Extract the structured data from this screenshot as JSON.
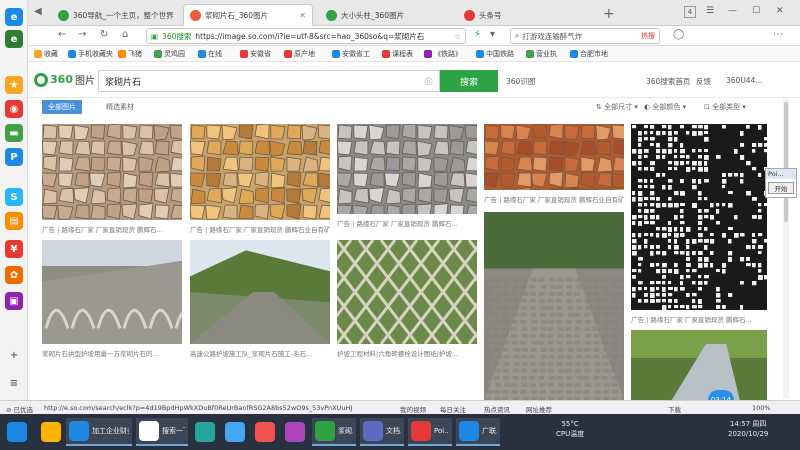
{
  "sidebar": {
    "icons": [
      {
        "name": "ie-icon",
        "glyph": "e",
        "color": "#1e88e5"
      },
      {
        "name": "ie-icon-2",
        "glyph": "e",
        "color": "#2e7d32"
      },
      {
        "name": "star-icon",
        "glyph": "★",
        "color": "#f5a623"
      },
      {
        "name": "weibo-icon",
        "glyph": "◉",
        "color": "#e53935"
      },
      {
        "name": "card-icon",
        "glyph": "▬",
        "color": "#43a047"
      },
      {
        "name": "p-icon",
        "glyph": "P",
        "color": "#1e88e5"
      },
      {
        "name": "s-icon",
        "glyph": "S",
        "color": "#29b6f6"
      },
      {
        "name": "book-icon",
        "glyph": "▤",
        "color": "#fb8c00"
      },
      {
        "name": "money-icon",
        "glyph": "¥",
        "color": "#e53935"
      },
      {
        "name": "gear-icon",
        "glyph": "✿",
        "color": "#ef6c00"
      },
      {
        "name": "box-icon",
        "glyph": "▣",
        "color": "#8e24aa"
      }
    ]
  },
  "tabs": [
    {
      "label": "360导航_一个主页，整个世界",
      "color": "#2da344"
    },
    {
      "label": "浆砌片石_360图片",
      "color": "#e85d3c",
      "active": true
    },
    {
      "label": "大小头柱_360图片",
      "color": "#2da344"
    },
    {
      "label": "头条号",
      "color": "#e53935"
    }
  ],
  "window": {
    "badge": "4"
  },
  "address": {
    "prefix": "360搜索",
    "url": "https://image.so.com/i?ie=utf-8&src=hao_360so&q=浆砌片石",
    "search_text": "打游戏连输醉气炸",
    "hot": "热搜"
  },
  "bookmarks": [
    {
      "label": "收藏",
      "color": "#f5a623"
    },
    {
      "label": "手机收藏夹",
      "color": "#1e88e5"
    },
    {
      "label": "飞猪",
      "color": "#fb8c00"
    },
    {
      "label": "灵鸡园",
      "color": "#43a047"
    },
    {
      "label": "在线",
      "color": "#1e88e5"
    },
    {
      "label": "安徽省",
      "color": "#e53935"
    },
    {
      "label": "原产地",
      "color": "#e53935"
    },
    {
      "label": "安徽省工",
      "color": "#1e88e5"
    },
    {
      "label": "课程表",
      "color": "#e53935"
    },
    {
      "label": "《铁路》",
      "color": "#8e24aa"
    },
    {
      "label": "中国铁路",
      "color": "#1e88e5"
    },
    {
      "label": "营业执",
      "color": "#43a047"
    },
    {
      "label": "合肥市地",
      "color": "#1e88e5"
    }
  ],
  "header": {
    "logo_brand": "360",
    "logo_suffix": "图片",
    "query": "浆砌片石",
    "search_button": "搜索",
    "links": [
      "360识图",
      "360搜索首页",
      "反馈",
      "360U44..."
    ]
  },
  "filters": {
    "tab_all": "全部图片",
    "tab_fine": "精选素材",
    "size": "全部尺寸",
    "color": "全部颜色",
    "type": "全部类型"
  },
  "images": [
    {
      "caption": "广告 | 路缘石厂家 厂家直销现货 鹏辉石...",
      "bg": "#b49a82",
      "pattern": "flag-beige"
    },
    {
      "caption": "广告 | 路缘石厂家 厂家直销现货 鹏辉石业自有矿山 案...",
      "bg": "#c8a46a",
      "pattern": "flag-orange"
    },
    {
      "caption": "广告 | 路缘石厂家 厂家直销现货 鹏辉石...",
      "bg": "#8a8a8a",
      "pattern": "flag-grey"
    },
    {
      "caption": "广告 | 路缘石厂家 厂家直销现货 鹏辉石业自有矿山 高...",
      "bg": "#b55a2e",
      "pattern": "flag-red"
    },
    {
      "caption": "广告 | 路缘石厂家 厂家直销现货 鹏辉石...",
      "bg": "#1a1a1a",
      "pattern": "mosaic-bw"
    },
    {
      "caption": "浆砌片石拱型护坡用量一方浆砌片石的...",
      "bg": "#8d8d85",
      "pattern": "slope"
    },
    {
      "caption": "高速公路护坡施工队_浆砌片石施工-毛石...",
      "bg": "#7a8a6a",
      "pattern": "road-build"
    },
    {
      "caption": "护坡工程材料|六角砖螺栓设计图纸|护坡...",
      "bg": "#6a7a4a",
      "pattern": "grid-slope"
    },
    {
      "caption": "",
      "bg": "#8a8880",
      "pattern": "path"
    },
    {
      "caption": "广告 | 路缘石厂家 厂家直销现货 鹏辉石...",
      "bg": "#5a7a3a",
      "pattern": "ditch"
    }
  ],
  "popup": {
    "title": "Poi...",
    "button": "开始"
  },
  "timer": "03:14",
  "status": {
    "left": "已优选",
    "url": "http://e.so.com/search/eclk?p=4d19BpdHpWkXDuBf0ReUrBanfRSG2A8bs52wO9s_53vPnXUuHJ",
    "items": [
      "我的视频",
      "每日关注",
      "热点资讯",
      "网址推荐",
      "下载",
      "100%"
    ]
  },
  "taskbar": {
    "items": [
      {
        "label": "",
        "color": "#1e88e5"
      },
      {
        "label": "",
        "color": "#ffb300"
      },
      {
        "label": "加工企业财务处理",
        "color": "#1e88e5"
      },
      {
        "label": "搜索一下",
        "color": "#ffffff"
      },
      {
        "label": "",
        "color": "#26a69a"
      },
      {
        "label": "",
        "color": "#42a5f5"
      },
      {
        "label": "",
        "color": "#ef5350"
      },
      {
        "label": "",
        "color": "#ab47bc"
      },
      {
        "label": "浆砌...",
        "color": "#2da344"
      },
      {
        "label": "文档...",
        "color": "#5c6bc0"
      },
      {
        "label": "Poi...",
        "color": "#e53935"
      },
      {
        "label": "广联...",
        "color": "#1e88e5"
      }
    ],
    "temp": "55°C",
    "cpu": "CPU温度",
    "time": "14:57 周四",
    "date": "2020/10/29"
  }
}
